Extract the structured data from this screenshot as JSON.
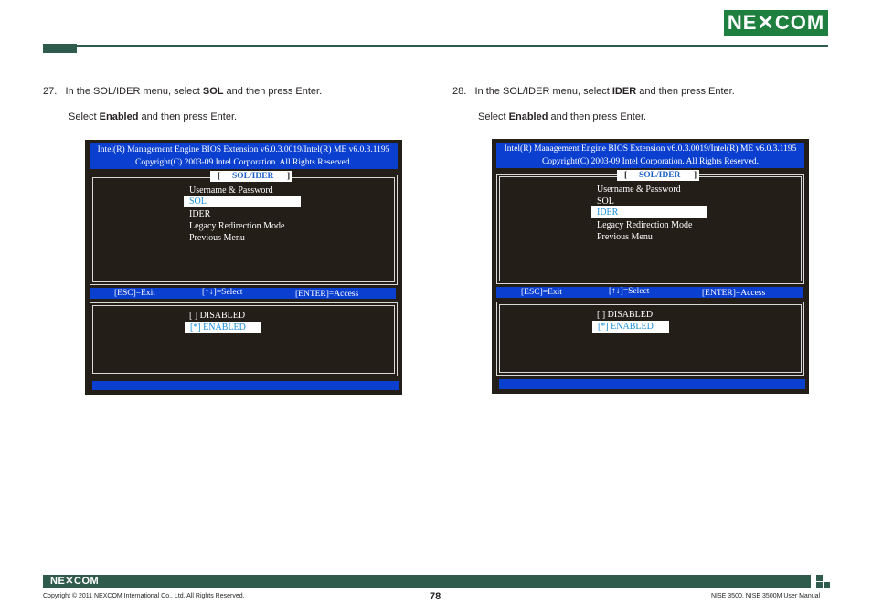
{
  "header": {
    "logo_text": "NE✕COM"
  },
  "steps": [
    {
      "number": "27.",
      "line1_prefix": "In the SOL/IDER menu, select ",
      "line1_bold": "SOL",
      "line1_suffix": " and then press Enter.",
      "line2_prefix": "Select ",
      "line2_bold": "Enabled",
      "line2_suffix": " and then press Enter."
    },
    {
      "number": "28.",
      "line1_prefix": "In the SOL/IDER menu, select ",
      "line1_bold": "IDER",
      "line1_suffix": " and then press Enter.",
      "line2_prefix": "Select ",
      "line2_bold": "Enabled",
      "line2_suffix": " and then press Enter."
    }
  ],
  "bios": {
    "title_line1": "Intel(R) Management Engine BIOS Extension v6.0.3.0019/Intel(R) ME v6.0.3.1195",
    "title_line2": "Copyright(C) 2003-09 Intel Corporation. All Rights Reserved.",
    "bracket_open": "[",
    "bracket_close": "]",
    "menu_title": "SOL/IDER",
    "menu_items": [
      "Username & Password",
      "SOL",
      "IDER",
      "Legacy Redirection Mode",
      "Previous Menu"
    ],
    "keys": {
      "esc": "[ESC]=Exit",
      "select": "[↑↓]=Select",
      "enter": "[ENTER]=Access"
    },
    "options": [
      "[ ] DISABLED",
      "[*] ENABLED"
    ],
    "colors": {
      "panel_bg": "#231e18",
      "bar_blue": "#0a3fcf",
      "highlight_text": "#1b8ed9"
    }
  },
  "footer": {
    "logo_text": "NE✕COM",
    "copyright": "Copyright © 2011 NEXCOM International Co., Ltd. All Rights Reserved.",
    "page_number": "78",
    "manual_title": "NISE 3500, NISE 3500M User Manual"
  }
}
